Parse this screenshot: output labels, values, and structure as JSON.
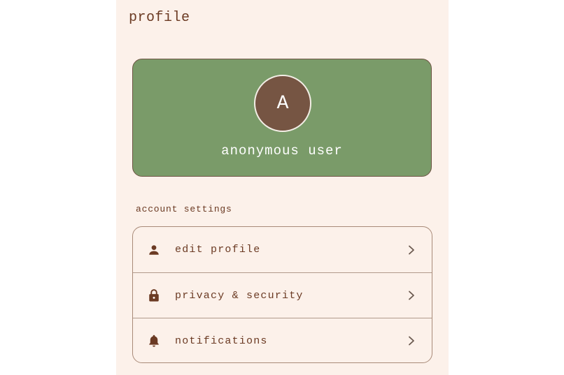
{
  "page": {
    "title": "profile"
  },
  "profile": {
    "avatar_initial": "A",
    "name": "anonymous user"
  },
  "account_settings": {
    "label": "account settings",
    "items": [
      {
        "label": "edit profile",
        "icon": "person-icon"
      },
      {
        "label": "privacy & security",
        "icon": "lock-icon"
      },
      {
        "label": "notifications",
        "icon": "bell-icon"
      }
    ]
  },
  "colors": {
    "background": "#fcf1ea",
    "card": "#7a9b69",
    "avatar": "#765543",
    "text": "#6b3a23"
  }
}
